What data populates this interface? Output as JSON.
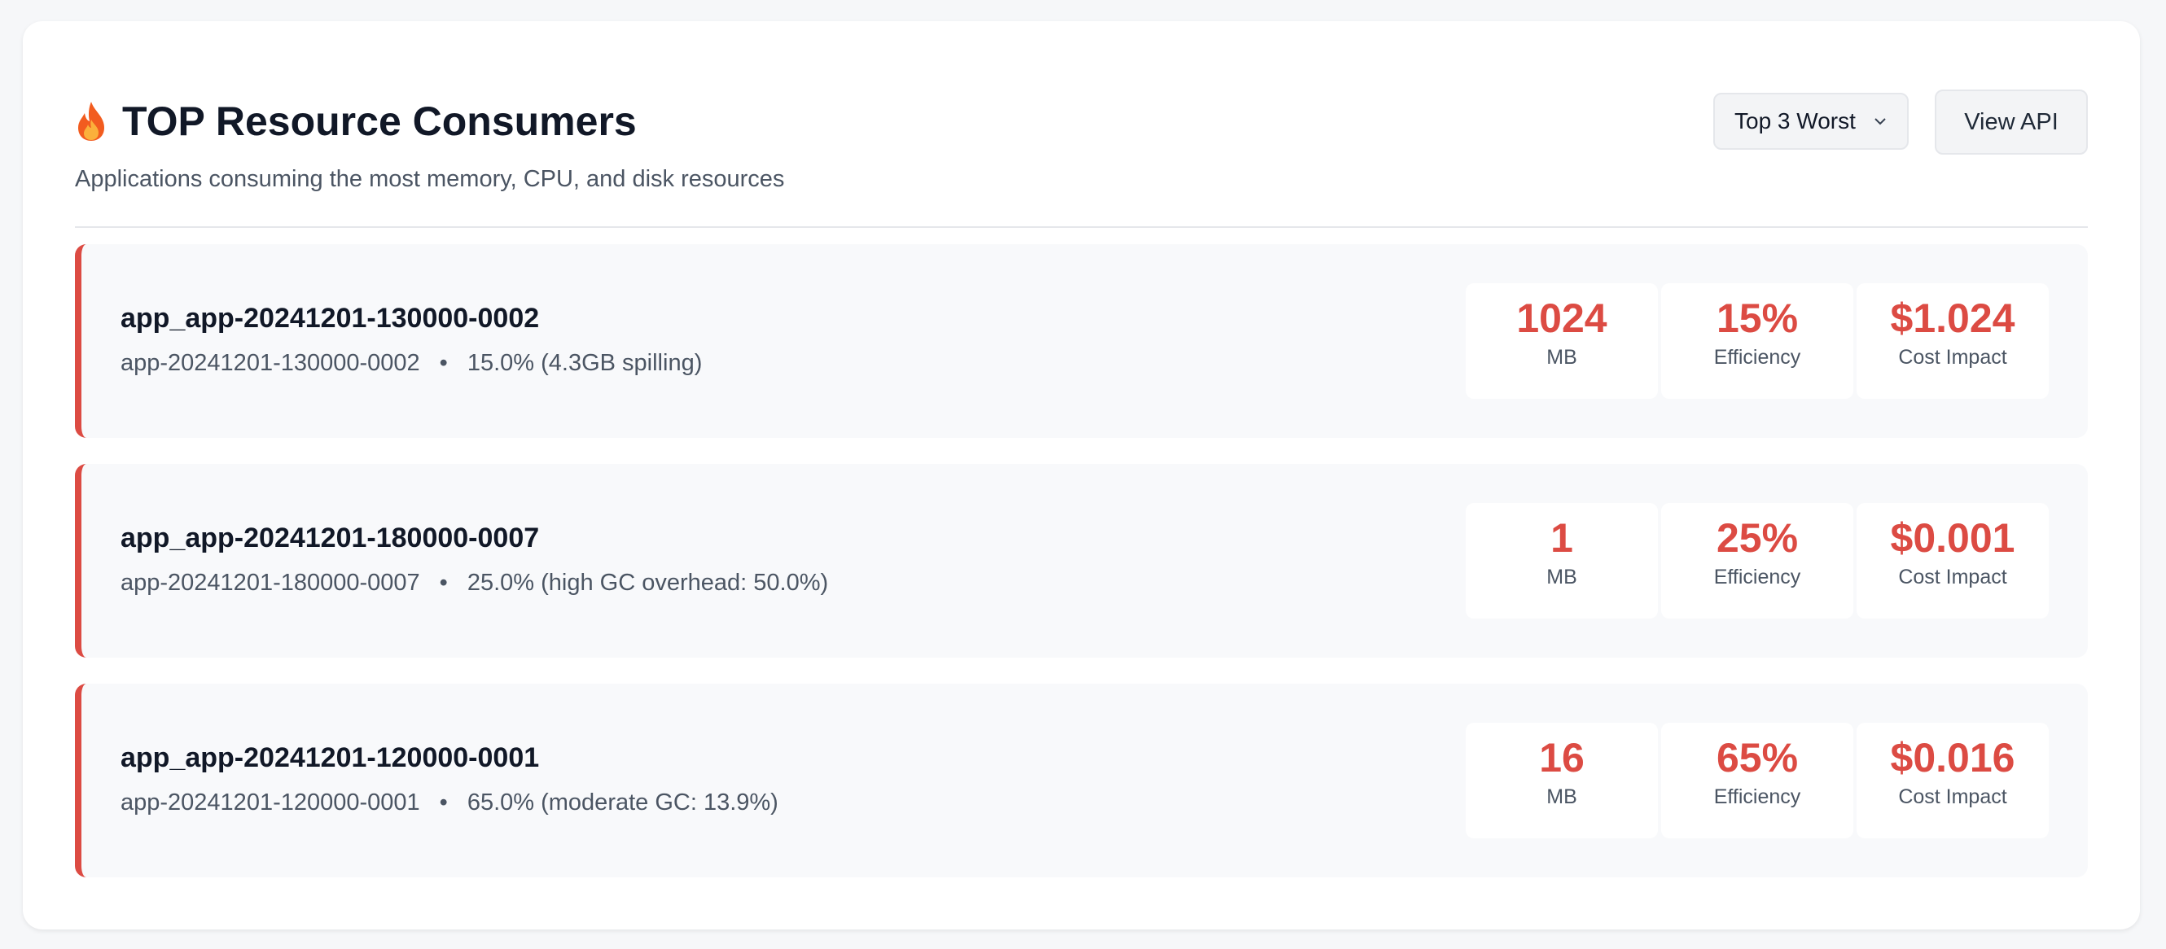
{
  "header": {
    "title": "TOP Resource Consumers",
    "subtitle": "Applications consuming the most memory, CPU, and disk resources",
    "filter_value": "Top 3 Worst",
    "view_api_label": "View API"
  },
  "colors": {
    "accent": "#dc4b43",
    "card_bg": "#f8f9fb"
  },
  "apps": [
    {
      "name": "app_app-20241201-130000-0002",
      "id": "app-20241201-130000-0002",
      "detail": "15.0% (4.3GB spilling)",
      "memory": "1024",
      "memory_unit": "MB",
      "efficiency": "15%",
      "efficiency_label": "Efficiency",
      "cost": "$1.024",
      "cost_label": "Cost Impact"
    },
    {
      "name": "app_app-20241201-180000-0007",
      "id": "app-20241201-180000-0007",
      "detail": "25.0% (high GC overhead: 50.0%)",
      "memory": "1",
      "memory_unit": "MB",
      "efficiency": "25%",
      "efficiency_label": "Efficiency",
      "cost": "$0.001",
      "cost_label": "Cost Impact"
    },
    {
      "name": "app_app-20241201-120000-0001",
      "id": "app-20241201-120000-0001",
      "detail": "65.0% (moderate GC: 13.9%)",
      "memory": "16",
      "memory_unit": "MB",
      "efficiency": "65%",
      "efficiency_label": "Efficiency",
      "cost": "$0.016",
      "cost_label": "Cost Impact"
    }
  ],
  "separator": "•"
}
